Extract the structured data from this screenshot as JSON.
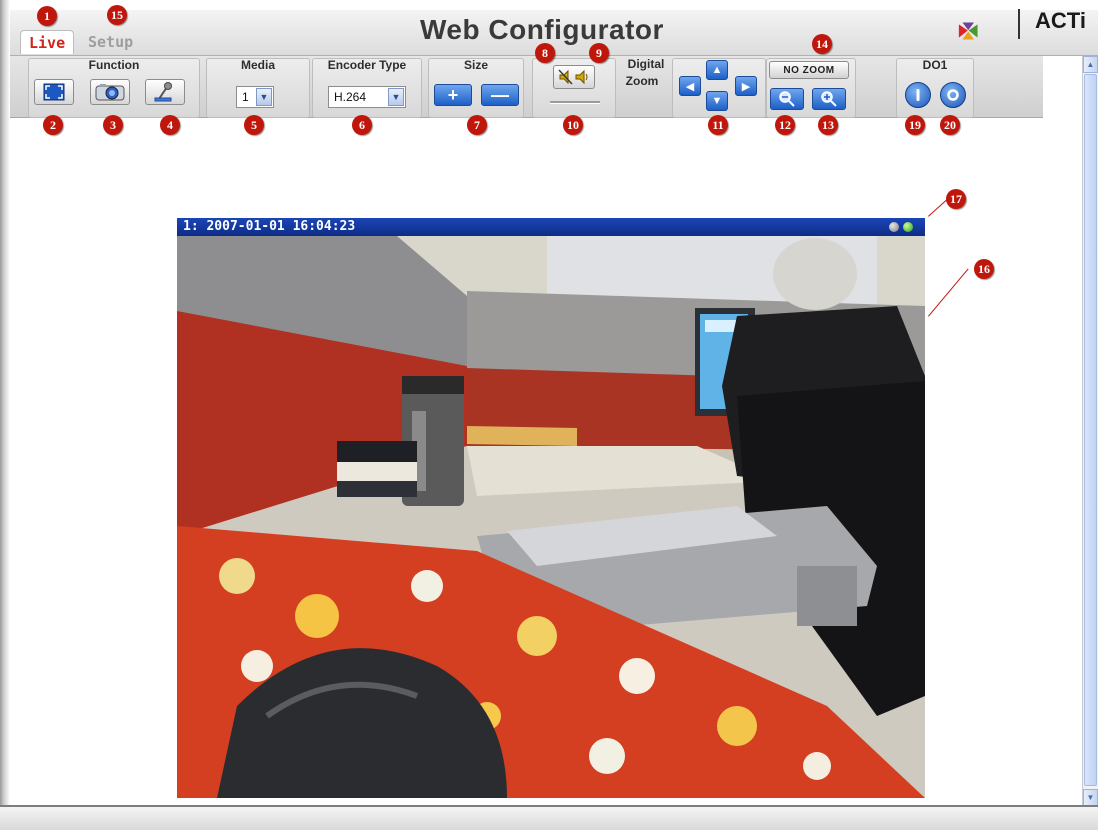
{
  "tabs": {
    "live": "Live",
    "setup": "Setup"
  },
  "header": {
    "title": "Web Configurator",
    "logo_text": "ACTi"
  },
  "toolbar": {
    "function_label": "Function",
    "media_label": "Media",
    "media_value": "1",
    "encoder_label": "Encoder Type",
    "encoder_value": "H.264",
    "size_label": "Size",
    "size_plus": "+",
    "size_minus": "—",
    "digital_zoom_label_1": "Digital",
    "digital_zoom_label_2": "Zoom",
    "no_zoom_label": "NO ZOOM",
    "do1_label": "DO1"
  },
  "video": {
    "overlay_text": "1:  2007-01-01 16:04:23"
  },
  "callouts": [
    "1",
    "2",
    "3",
    "4",
    "5",
    "6",
    "7",
    "8",
    "9",
    "10",
    "11",
    "12",
    "13",
    "14",
    "15",
    "16",
    "17",
    "19",
    "20"
  ],
  "icons": {
    "fullscreen": "fullscreen-icon",
    "snapshot": "camera-icon",
    "record": "microphone-icon",
    "speaker_mute": "speaker-mute-icon",
    "speaker": "speaker-icon",
    "zoom_out": "zoom-out-icon",
    "zoom_in": "zoom-in-icon",
    "do_on": "power-on-icon",
    "do_off": "power-off-icon"
  },
  "colors": {
    "accent_red": "#c0170c",
    "live_tab": "#d0261b",
    "button_blue": "#1d5fc7",
    "video_bar": "#0d2c86"
  }
}
